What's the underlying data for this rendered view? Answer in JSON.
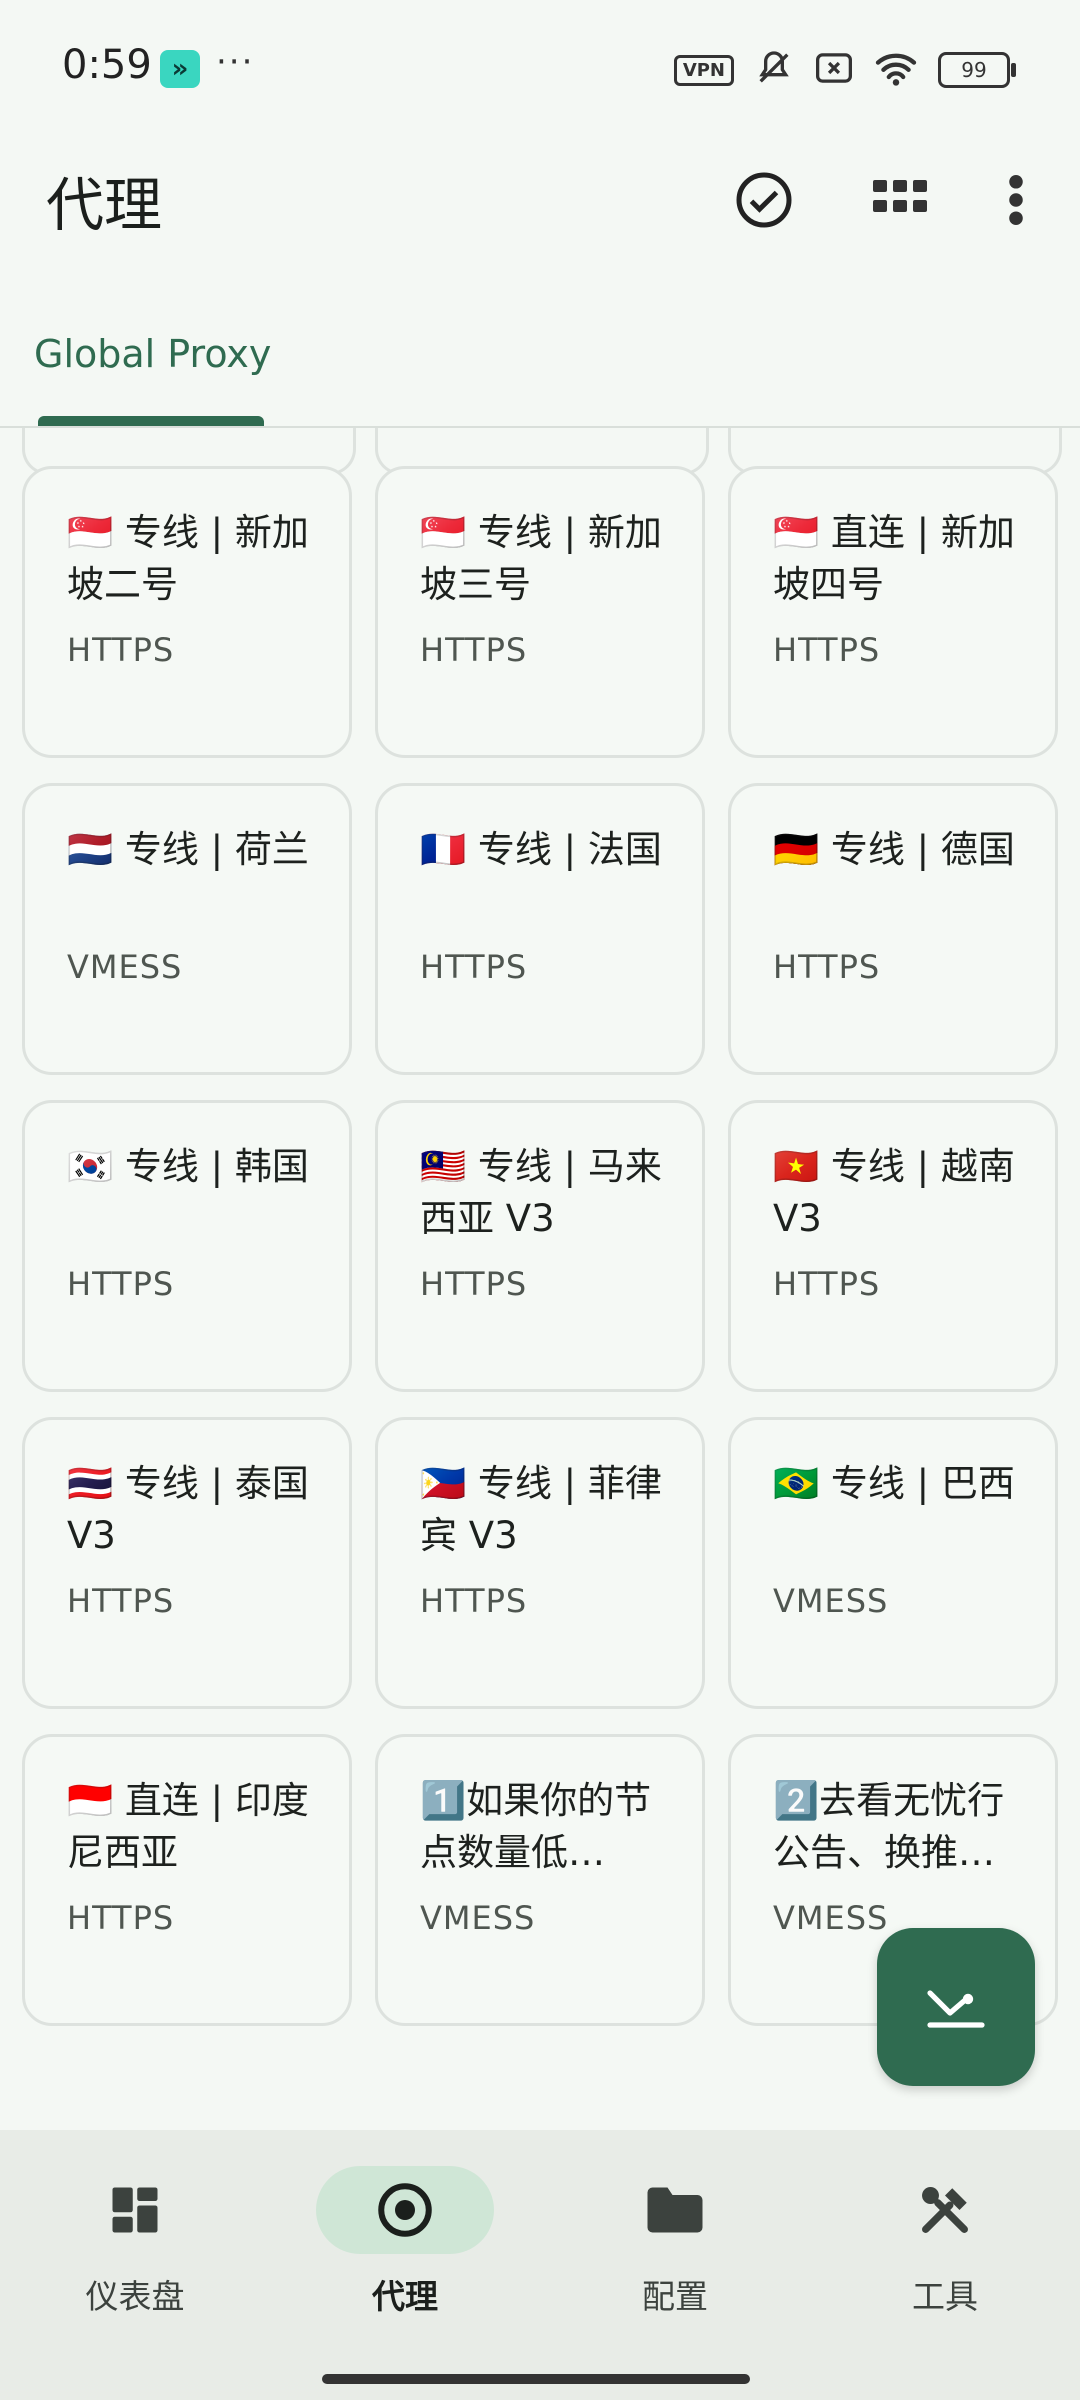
{
  "status_bar": {
    "time": "0:59",
    "app_chip": "»",
    "more": "···",
    "vpn": "VPN",
    "battery": "99"
  },
  "app_bar": {
    "title": "代理",
    "actions": [
      "check-circle-icon",
      "grid-icon",
      "more-vert-icon"
    ]
  },
  "tabs": [
    {
      "label": "Global Proxy",
      "selected": true
    }
  ],
  "proxies": [
    {
      "name": "🇸🇬 专线 | 新加坡二号",
      "type": "HTTPS"
    },
    {
      "name": "🇸🇬 专线 | 新加坡三号",
      "type": "HTTPS"
    },
    {
      "name": "🇸🇬 直连 | 新加坡四号",
      "type": "HTTPS"
    },
    {
      "name": "🇳🇱 专线 | 荷兰",
      "type": "VMESS"
    },
    {
      "name": "🇫🇷 专线 | 法国",
      "type": "HTTPS"
    },
    {
      "name": "🇩🇪 专线 | 德国",
      "type": "HTTPS"
    },
    {
      "name": "🇰🇷 专线 | 韩国",
      "type": "HTTPS"
    },
    {
      "name": "🇲🇾 专线 | 马来西亚 V3",
      "type": "HTTPS"
    },
    {
      "name": "🇻🇳 专线 | 越南 V3",
      "type": "HTTPS"
    },
    {
      "name": "🇹🇭 专线 | 泰国 V3",
      "type": "HTTPS"
    },
    {
      "name": "🇵🇭 专线 | 菲律宾 V3",
      "type": "HTTPS"
    },
    {
      "name": "🇧🇷 专线 | 巴西",
      "type": "VMESS"
    },
    {
      "name": "🇮🇩 直连 | 印度尼西亚",
      "type": "HTTPS"
    },
    {
      "name": "1️⃣如果你的节点数量低…",
      "type": "VMESS"
    },
    {
      "name": "2️⃣去看无忧行公告、换推…",
      "type": "VMESS"
    }
  ],
  "fab": {
    "icon": "locate-target-icon"
  },
  "bottom_nav": [
    {
      "label": "仪表盘",
      "icon": "dashboard-icon",
      "active": false
    },
    {
      "label": "代理",
      "icon": "radio-target-icon",
      "active": true
    },
    {
      "label": "配置",
      "icon": "folder-icon",
      "active": false
    },
    {
      "label": "工具",
      "icon": "tools-icon",
      "active": false
    }
  ],
  "colors": {
    "primary": "#2f6b50",
    "background": "#f4f8f4",
    "nav_active_pill": "#cfe6d6"
  }
}
